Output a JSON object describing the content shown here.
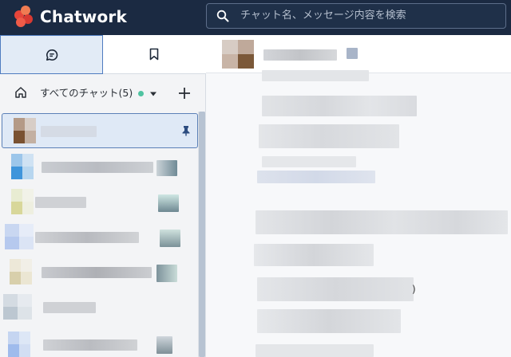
{
  "app": {
    "brand": "Chatwork",
    "colors": {
      "header_bg": "#1b2a42",
      "accent": "#4f7cc0",
      "online": "#4fc3a1",
      "logo": "#e6453a"
    }
  },
  "search": {
    "placeholder": "チャット名、メッセージ内容を検索",
    "icon": "search-icon"
  },
  "left_tabs": [
    {
      "name": "chat-tab",
      "icon": "chat-bubble-icon",
      "active": true
    },
    {
      "name": "bookmark-tab",
      "icon": "bookmark-icon",
      "active": false
    }
  ],
  "chat_filter": {
    "label": "すべてのチャット(5)",
    "icons": [
      "home-icon",
      "online-dot",
      "caret-down-icon",
      "plus-icon"
    ]
  },
  "chat_list": {
    "items": [
      {
        "selected": true,
        "pinned": true
      },
      {
        "selected": false,
        "pinned": false
      },
      {
        "selected": false,
        "pinned": false
      },
      {
        "selected": false,
        "pinned": false
      },
      {
        "selected": false,
        "pinned": false
      },
      {
        "selected": false,
        "pinned": false
      },
      {
        "selected": false,
        "pinned": false
      }
    ]
  },
  "message_pane": {
    "trailing_glyph": ")"
  }
}
